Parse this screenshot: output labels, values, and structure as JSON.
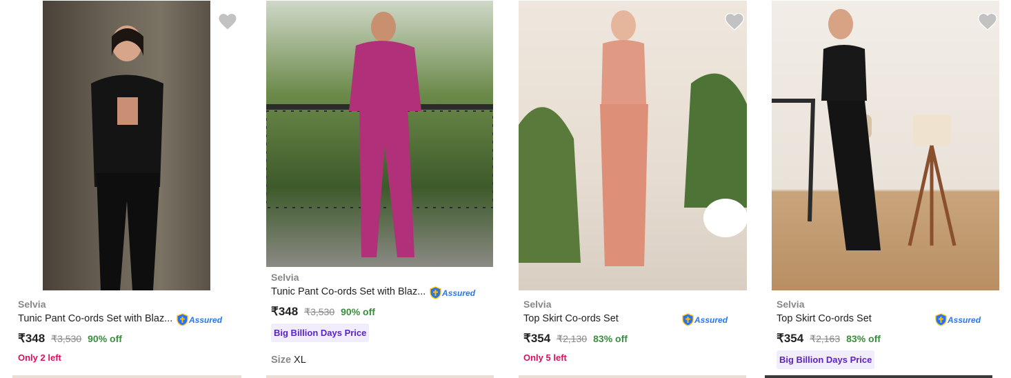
{
  "products": [
    {
      "brand": "Selvia",
      "title": "Tunic Pant Co-ords Set with Blaz...",
      "assured": "Assured",
      "price": "₹348",
      "mrp": "₹3,530",
      "discount": "90% off",
      "stock": "Only 2 left",
      "image": "black-coords-blazer-photo"
    },
    {
      "brand": "Selvia",
      "title": "Tunic Pant Co-ords Set with Blaz...",
      "assured": "Assured",
      "price": "₹348",
      "mrp": "₹3,530",
      "discount": "90% off",
      "tag": "Big Billion Days Price",
      "size_label": "Size",
      "size_value": "XL",
      "image": "magenta-coords-blazer-photo"
    },
    {
      "brand": "Selvia",
      "title": "Top Skirt Co-ords Set",
      "assured": "Assured",
      "price": "₹354",
      "mrp": "₹2,130",
      "discount": "83% off",
      "stock": "Only 5 left",
      "image": "peach-top-skirt-photo"
    },
    {
      "brand": "Selvia",
      "title": "Top Skirt Co-ords Set",
      "assured": "Assured",
      "price": "₹354",
      "mrp": "₹2,163",
      "discount": "83% off",
      "tag": "Big Billion Days Price",
      "image": "black-top-skirt-photo"
    }
  ],
  "colors": {
    "price_off": "#388e3c",
    "stock_alert": "#d6115f",
    "assured_blue": "#2874f0",
    "bbd_bg": "#f1edfd",
    "bbd_text": "#5b22c6"
  }
}
